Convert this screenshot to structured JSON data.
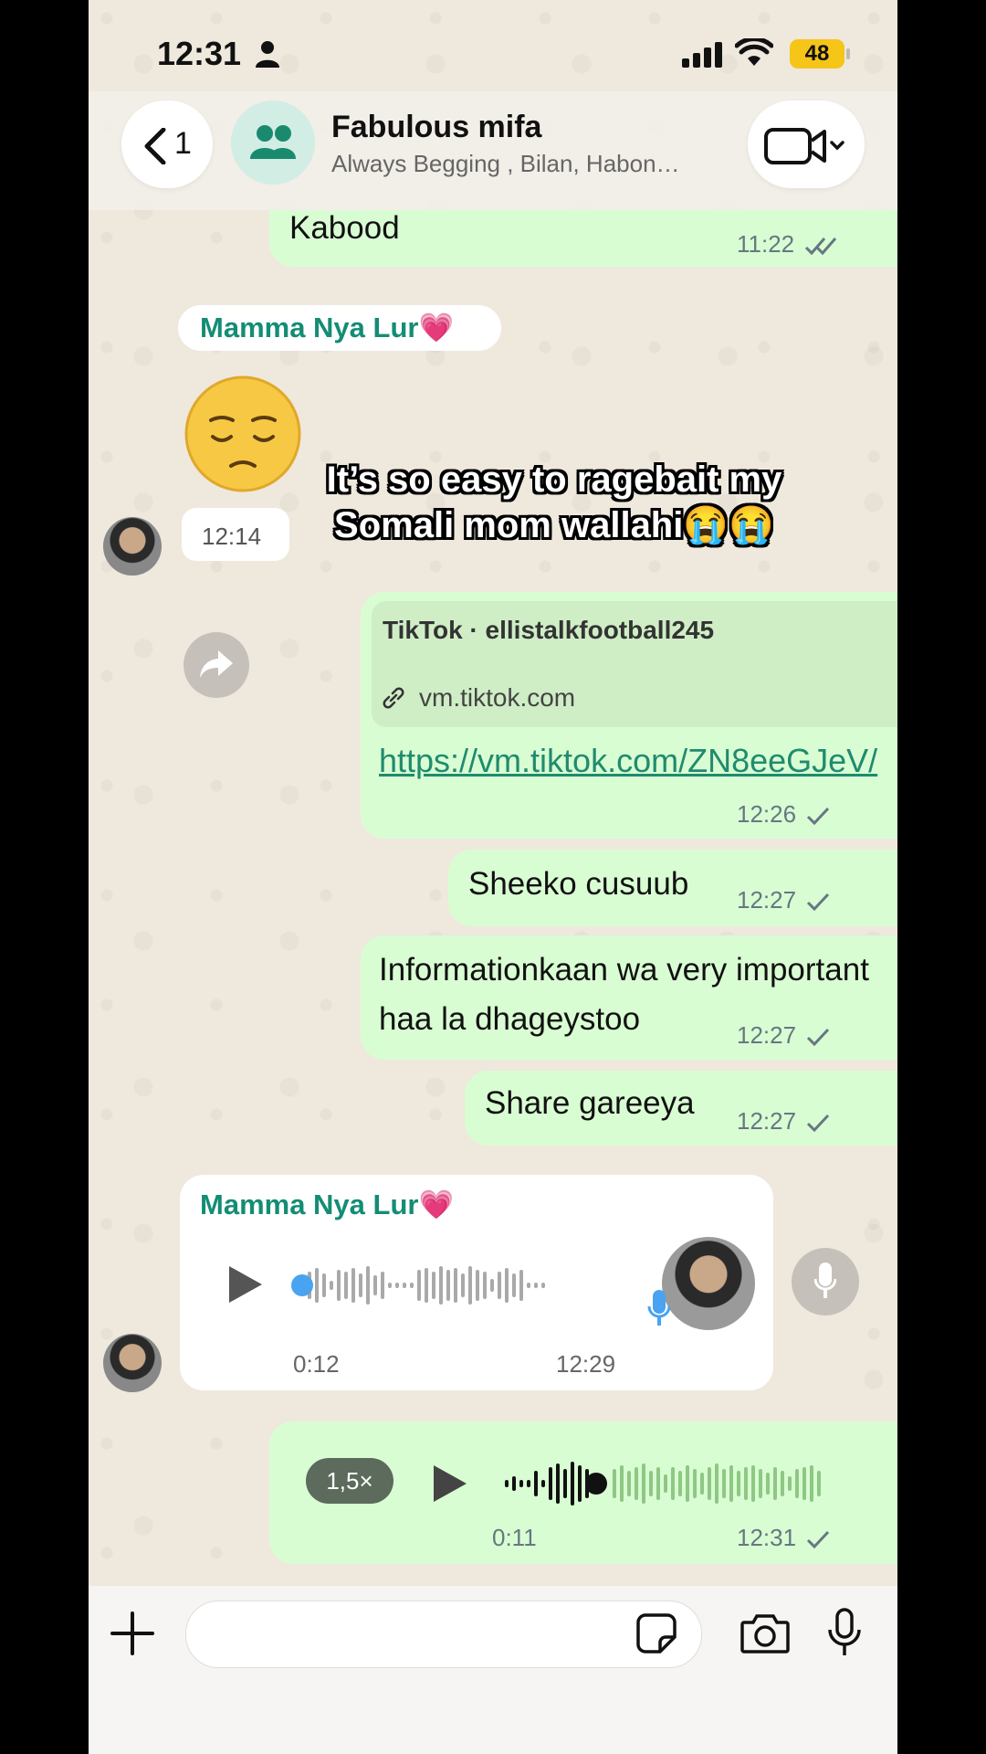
{
  "status_bar": {
    "time": "12:31",
    "battery": "48"
  },
  "header": {
    "back_count": "1",
    "title": "Fabulous mifa",
    "subtitle": "Always Begging , Bilan, Habon…"
  },
  "messages": [
    {
      "type": "out",
      "text": "Kabood",
      "time": "11:22",
      "status": "read"
    },
    {
      "type": "in",
      "sender": "Mamma Nya Lur💗",
      "emoji": "😔",
      "time": "12:14"
    },
    {
      "type": "out_link",
      "link_title": "TikTok · ellistalkfootball245",
      "domain": "vm.tiktok.com",
      "url": "https://vm.tiktok.com/ZN8eeGJeV/",
      "time": "12:26",
      "status": "sent"
    },
    {
      "type": "out",
      "text": "Sheeko cusuub",
      "time": "12:27",
      "status": "sent"
    },
    {
      "type": "out",
      "text_line1": "Informationkaan wa very important",
      "text_line2": "haa la dhageystoo",
      "time": "12:27",
      "status": "sent"
    },
    {
      "type": "out",
      "text": "Share gareeya",
      "time": "12:27",
      "status": "sent"
    },
    {
      "type": "in_voice",
      "sender": "Mamma Nya Lur💗",
      "duration": "0:12",
      "time": "12:29"
    },
    {
      "type": "out_voice",
      "speed": "1,5×",
      "duration": "0:11",
      "time": "12:31",
      "status": "sent"
    }
  ],
  "overlay_caption": {
    "line1": "It’s so easy to ragebait my",
    "line2": "Somali mom wallahi😭😭"
  },
  "icons": {
    "back": "chevron-left-icon",
    "group": "group-icon",
    "video": "video-camera-icon",
    "forward": "forward-icon",
    "link": "link-icon",
    "mic": "microphone-icon",
    "play": "play-icon",
    "plus": "plus-icon",
    "sticker": "sticker-icon",
    "camera": "camera-icon"
  },
  "colors": {
    "outgoing_bubble": "#d9fdd3",
    "incoming_bubble": "#ffffff",
    "sender_name": "#138d75",
    "link": "#1f8b6f",
    "battery": "#f5c518",
    "waveform_played_in": "#4aa3f0"
  }
}
